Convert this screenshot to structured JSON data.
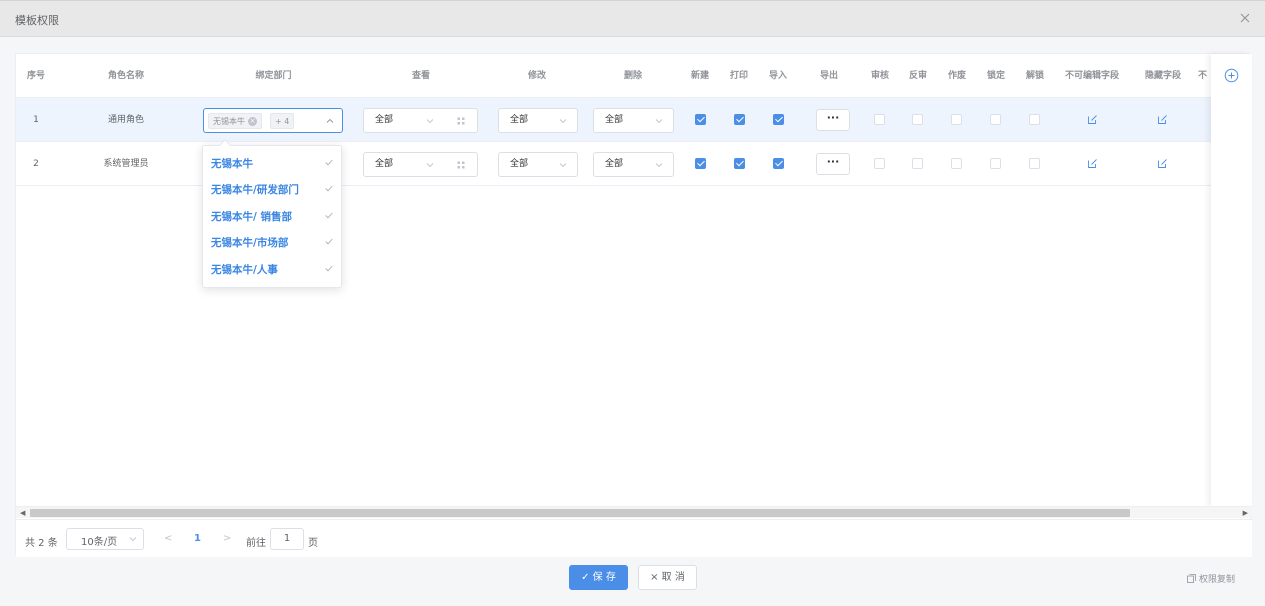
{
  "dialog": {
    "title": "模板权限"
  },
  "table": {
    "headers": [
      "序号",
      "角色名称",
      "绑定部门",
      "查看",
      "修改",
      "删除",
      "新建",
      "打印",
      "导入",
      "导出",
      "审核",
      "反审",
      "作废",
      "锁定",
      "解锁",
      "不可编辑字段",
      "隐藏字段",
      "不"
    ],
    "rows": [
      {
        "index": "1",
        "role": "通用角色",
        "dept_tag": "无锡本牛",
        "dept_more": "+ 4",
        "view": "全部",
        "edit": "全部",
        "delete": "全部",
        "create": true,
        "print": true,
        "import": true,
        "export_label": "···",
        "audit": false,
        "unaudit": false,
        "void": false,
        "lock": false,
        "unlock": false
      },
      {
        "index": "2",
        "role": "系统管理员",
        "view": "全部",
        "edit": "全部",
        "delete": "全部",
        "create": true,
        "print": true,
        "import": true,
        "export_label": "···",
        "audit": false,
        "unaudit": false,
        "void": false,
        "lock": false,
        "unlock": false
      }
    ]
  },
  "dropdown": {
    "items": [
      "无锡本牛",
      "无锡本牛/研发部门",
      "无锡本牛/ 销售部",
      "无锡本牛/市场部",
      "无锡本牛/人事"
    ]
  },
  "pager": {
    "total": "共 2 条",
    "page_size": "10条/页",
    "prev": "<",
    "current": "1",
    "next": ">",
    "goto_label": "前往",
    "goto_value": "1",
    "page_label": "页"
  },
  "footer": {
    "save": "✓ 保 存",
    "cancel": "× 取 消",
    "copy_perm": "权限复制"
  },
  "colors": {
    "primary": "#4a8ee8",
    "row_highlight": "#eef4fd"
  }
}
